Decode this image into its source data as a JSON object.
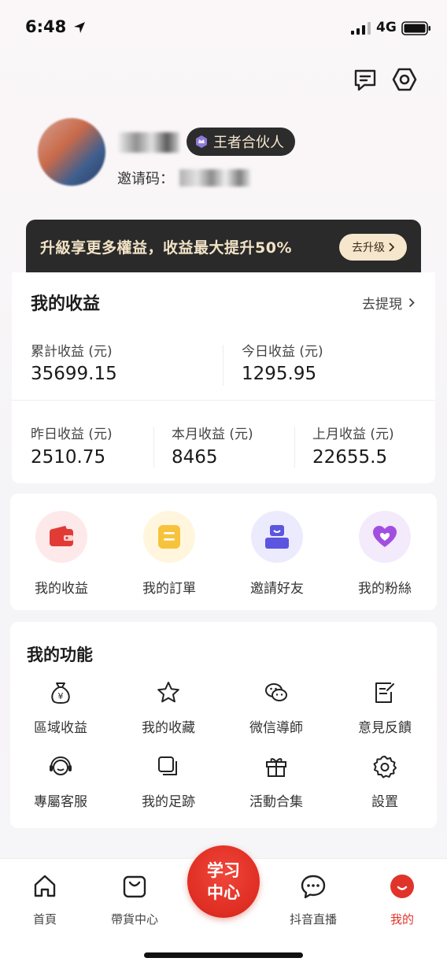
{
  "status_bar": {
    "time": "6:48",
    "network": "4G"
  },
  "profile": {
    "badge": "王者合伙人",
    "invite_label": "邀请码："
  },
  "banner": {
    "text": "升級享更多權益，收益最大提升50%",
    "button": "去升级"
  },
  "earnings": {
    "title": "我的收益",
    "withdraw": "去提現",
    "total_label": "累計收益 (元)",
    "total_value": "35699.15",
    "today_label": "今日收益 (元)",
    "today_value": "1295.95",
    "yesterday_label": "昨日收益 (元)",
    "yesterday_value": "2510.75",
    "month_label": "本月收益 (元)",
    "month_value": "8465",
    "last_month_label": "上月收益 (元)",
    "last_month_value": "22655.5"
  },
  "quick": [
    {
      "label": "我的收益",
      "icon": "wallet-icon",
      "bg": "#fde9e9",
      "color": "#e23b36"
    },
    {
      "label": "我的訂單",
      "icon": "order-icon",
      "bg": "#fff6dd",
      "color": "#f7c33c"
    },
    {
      "label": "邀請好友",
      "icon": "invite-icon",
      "bg": "#ecebfd",
      "color": "#5b55e0"
    },
    {
      "label": "我的粉絲",
      "icon": "fans-heart-icon",
      "bg": "#f3eafc",
      "color": "#a24fe0"
    }
  ],
  "features": {
    "title": "我的功能",
    "items": [
      {
        "label": "區域收益",
        "icon": "money-bag-icon"
      },
      {
        "label": "我的收藏",
        "icon": "star-icon"
      },
      {
        "label": "微信導師",
        "icon": "wechat-icon"
      },
      {
        "label": "意見反饋",
        "icon": "feedback-icon"
      },
      {
        "label": "專屬客服",
        "icon": "headset-icon"
      },
      {
        "label": "我的足跡",
        "icon": "footprint-icon"
      },
      {
        "label": "活動合集",
        "icon": "gift-icon"
      },
      {
        "label": "設置",
        "icon": "settings-icon"
      }
    ]
  },
  "tabbar": {
    "home": "首頁",
    "shop": "帶貨中心",
    "center_line1": "学习",
    "center_line2": "中心",
    "live": "抖音直播",
    "mine": "我的",
    "active_color": "#e0342b"
  }
}
